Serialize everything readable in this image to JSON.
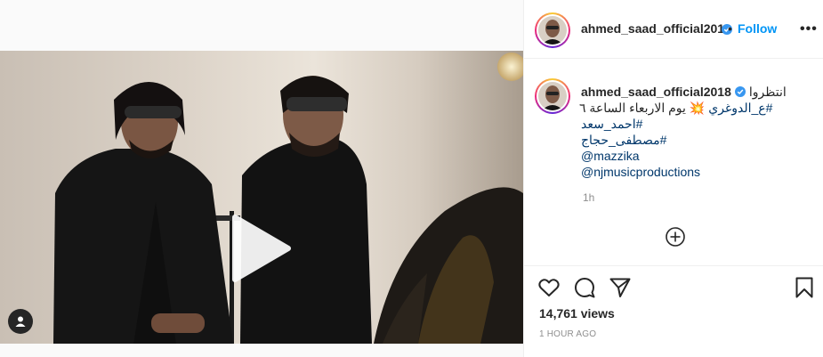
{
  "post": {
    "username": "ahmed_saad_official2018",
    "verified": true,
    "dot_separator": "•",
    "follow_label": "Follow",
    "more_label": "•••",
    "caption": {
      "line1_text": "انتظروا",
      "line2_hashtag": "#ع_الدوغري",
      "line2_text": "💥 يوم الاربعاء الساعة ٦",
      "line3_hashtag": "#احمد_سعد",
      "line4_hashtag": "#مصطفى_حجاج",
      "line5_mention": "@mazzika",
      "line6_mention": "@njmusicproductions"
    },
    "caption_age": "1h",
    "views_label": "14,761 views",
    "posted_ago": "1 HOUR AGO"
  },
  "icons": {
    "play": "play-icon",
    "user_tag": "user-tag-icon",
    "verified": "verified-badge-icon",
    "load_more": "plus-circle-icon",
    "like": "heart-icon",
    "comment": "comment-icon",
    "share": "paper-plane-icon",
    "save": "bookmark-icon"
  },
  "colors": {
    "accent": "#0095f6",
    "hashtag": "#00376b",
    "muted": "#8e8e8e",
    "text": "#262626",
    "border": "#efefef"
  }
}
